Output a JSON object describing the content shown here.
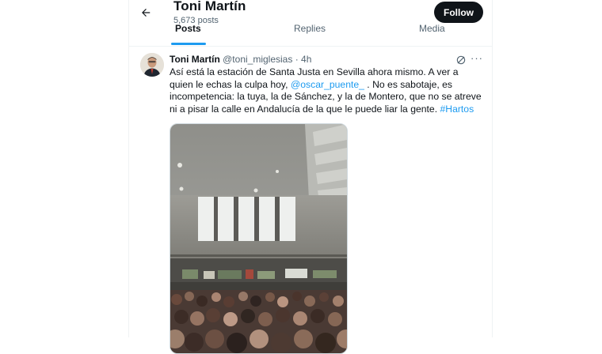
{
  "header": {
    "name": "Toni Martín",
    "posts_count": "5,673 posts",
    "follow_label": "Follow"
  },
  "tabs": [
    {
      "label": "Posts",
      "active": true
    },
    {
      "label": "Replies",
      "active": false
    },
    {
      "label": "Media",
      "active": false
    }
  ],
  "tweet": {
    "author_name": "Toni Martín",
    "handle": "@toni_miglesias",
    "separator": "·",
    "time": "4h",
    "text_part1": "Así está la estación de Santa Justa en Sevilla ahora mismo. A ver a quien le echas la culpa hoy, ",
    "mention": "@oscar_puente_",
    "text_part2": " . No es sabotaje, es incompetencia: la tuya, la de Sánchez, y la de Montero, que no se atreve ni a pisar la calle en Andalucía de la que le puede liar la gente. ",
    "hashtag": "#Hartos",
    "more_label": "···"
  },
  "icons": {
    "back": "arrow-left-icon",
    "grok": "grok-icon",
    "more": "more-horizontal-icon"
  },
  "colors": {
    "accent": "#1d9bf0",
    "text": "#0f1419",
    "secondary": "#536471",
    "follow_bg": "#0f1419"
  }
}
